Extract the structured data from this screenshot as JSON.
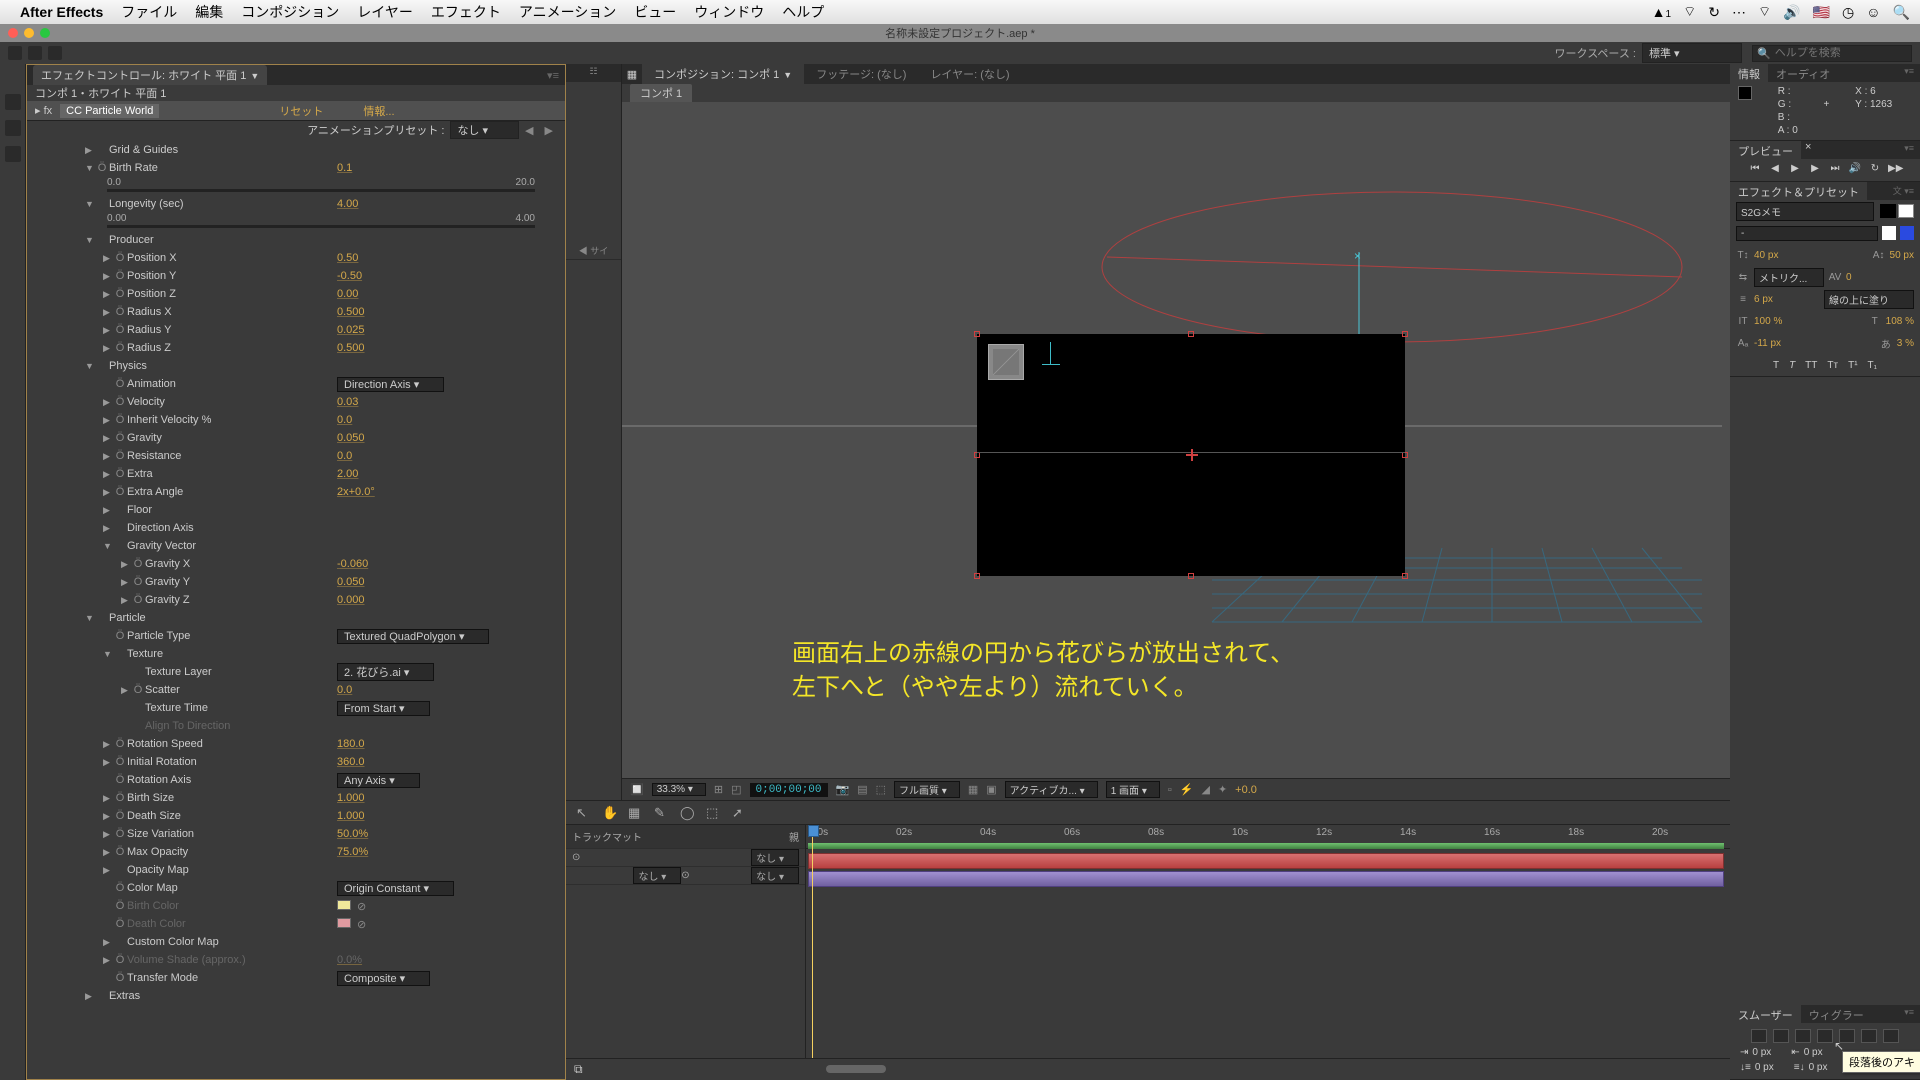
{
  "mac_menu": {
    "app": "After Effects",
    "items": [
      "ファイル",
      "編集",
      "コンポジション",
      "レイヤー",
      "エフェクト",
      "アニメーション",
      "ビュー",
      "ウィンドウ",
      "ヘルプ"
    ],
    "right_badge": "1"
  },
  "window_title": "名称未設定プロジェクト.aep *",
  "workspace": {
    "label": "ワークスペース :",
    "value": "標準",
    "search_placeholder": "ヘルプを検索"
  },
  "effect_panel": {
    "tab": "エフェクトコントロール: ホワイト 平面 1",
    "subtitle": "コンポ 1・ホワイト 平面 1",
    "effect_name": "CC Particle World",
    "reset": "リセット",
    "info": "情報...",
    "anim_preset_label": "アニメーションプリセット :",
    "anim_preset_value": "なし",
    "rows": [
      {
        "indent": 1,
        "tw": "r",
        "label": "Grid & Guides",
        "value": null
      },
      {
        "indent": 1,
        "tw": "d",
        "sw": "Ö",
        "label": "Birth Rate",
        "value": "0.1"
      },
      {
        "slider": true,
        "min": "0.0",
        "max": "20.0"
      },
      {
        "indent": 1,
        "tw": "d",
        "label": "Longevity (sec)",
        "value": "4.00"
      },
      {
        "slider": true,
        "min": "0.00",
        "max": "4.00"
      },
      {
        "indent": 1,
        "tw": "d",
        "label": "Producer",
        "value": null
      },
      {
        "indent": 2,
        "tw": "r",
        "sw": "Ö",
        "label": "Position X",
        "value": "0.50"
      },
      {
        "indent": 2,
        "tw": "r",
        "sw": "Ö",
        "label": "Position Y",
        "value": "-0.50"
      },
      {
        "indent": 2,
        "tw": "r",
        "sw": "Ö",
        "label": "Position Z",
        "value": "0.00"
      },
      {
        "indent": 2,
        "tw": "r",
        "sw": "Ö",
        "label": "Radius X",
        "value": "0.500"
      },
      {
        "indent": 2,
        "tw": "r",
        "sw": "Ö",
        "label": "Radius Y",
        "value": "0.025"
      },
      {
        "indent": 2,
        "tw": "r",
        "sw": "Ö",
        "label": "Radius Z",
        "value": "0.500"
      },
      {
        "indent": 1,
        "tw": "d",
        "label": "Physics",
        "value": null
      },
      {
        "indent": 2,
        "tw": "",
        "sw": "Ö",
        "label": "Animation",
        "dropdown": "Direction Axis"
      },
      {
        "indent": 2,
        "tw": "r",
        "sw": "Ö",
        "label": "Velocity",
        "value": "0.03"
      },
      {
        "indent": 2,
        "tw": "r",
        "sw": "Ö",
        "label": "Inherit Velocity %",
        "value": "0.0"
      },
      {
        "indent": 2,
        "tw": "r",
        "sw": "Ö",
        "label": "Gravity",
        "value": "0.050"
      },
      {
        "indent": 2,
        "tw": "r",
        "sw": "Ö",
        "label": "Resistance",
        "value": "0.0"
      },
      {
        "indent": 2,
        "tw": "r",
        "sw": "Ö",
        "label": "Extra",
        "value": "2.00"
      },
      {
        "indent": 2,
        "tw": "r",
        "sw": "Ö",
        "label": "Extra Angle",
        "value": "2x+0.0°"
      },
      {
        "indent": 2,
        "tw": "r",
        "label": "Floor",
        "value": null
      },
      {
        "indent": 2,
        "tw": "r",
        "label": "Direction Axis",
        "value": null
      },
      {
        "indent": 2,
        "tw": "d",
        "label": "Gravity Vector",
        "value": null
      },
      {
        "indent": 3,
        "tw": "r",
        "sw": "Ö",
        "label": "Gravity X",
        "value": "-0.060"
      },
      {
        "indent": 3,
        "tw": "r",
        "sw": "Ö",
        "label": "Gravity Y",
        "value": "0.050"
      },
      {
        "indent": 3,
        "tw": "r",
        "sw": "Ö",
        "label": "Gravity Z",
        "value": "0.000"
      },
      {
        "indent": 1,
        "tw": "d",
        "label": "Particle",
        "value": null
      },
      {
        "indent": 2,
        "tw": "",
        "sw": "Ö",
        "label": "Particle Type",
        "dropdown": "Textured QuadPolygon"
      },
      {
        "indent": 2,
        "tw": "d",
        "label": "Texture",
        "value": null
      },
      {
        "indent": 3,
        "tw": "",
        "label": "Texture Layer",
        "dropdown": "2. 花びら.ai"
      },
      {
        "indent": 3,
        "tw": "r",
        "sw": "Ö",
        "label": "Scatter",
        "value": "0.0"
      },
      {
        "indent": 3,
        "tw": "",
        "label": "Texture Time",
        "dropdown": "From Start"
      },
      {
        "indent": 3,
        "tw": "",
        "label": "Align To Direction",
        "value": null,
        "disabled": true
      },
      {
        "indent": 2,
        "tw": "r",
        "sw": "Ö",
        "label": "Rotation Speed",
        "value": "180.0"
      },
      {
        "indent": 2,
        "tw": "r",
        "sw": "Ö",
        "label": "Initial Rotation",
        "value": "360.0"
      },
      {
        "indent": 2,
        "tw": "",
        "sw": "Ö",
        "label": "Rotation Axis",
        "dropdown": "Any Axis"
      },
      {
        "indent": 2,
        "tw": "r",
        "sw": "Ö",
        "label": "Birth Size",
        "value": "1.000"
      },
      {
        "indent": 2,
        "tw": "r",
        "sw": "Ö",
        "label": "Death Size",
        "value": "1.000"
      },
      {
        "indent": 2,
        "tw": "r",
        "sw": "Ö",
        "label": "Size Variation",
        "value": "50.0%"
      },
      {
        "indent": 2,
        "tw": "r",
        "sw": "Ö",
        "label": "Max Opacity",
        "value": "75.0%"
      },
      {
        "indent": 2,
        "tw": "r",
        "label": "Opacity Map",
        "value": null
      },
      {
        "indent": 2,
        "tw": "",
        "sw": "Ö",
        "label": "Color Map",
        "dropdown": "Origin Constant"
      },
      {
        "indent": 2,
        "tw": "",
        "sw": "Ö",
        "label": "Birth Color",
        "swatch": "#f0e89a",
        "disabled": true
      },
      {
        "indent": 2,
        "tw": "",
        "sw": "Ö",
        "label": "Death Color",
        "swatch": "#e09aa0",
        "disabled": true
      },
      {
        "indent": 2,
        "tw": "r",
        "label": "Custom Color Map",
        "value": null
      },
      {
        "indent": 2,
        "tw": "r",
        "sw": "Ö",
        "label": "Volume Shade (approx.)",
        "value": "0.0%",
        "disabled": true
      },
      {
        "indent": 2,
        "tw": "",
        "sw": "Ö",
        "label": "Transfer Mode",
        "dropdown": "Composite"
      },
      {
        "indent": 1,
        "tw": "r",
        "label": "Extras",
        "value": null
      }
    ]
  },
  "project_stub_head": "サイ",
  "viewer": {
    "tabs": [
      {
        "label": "コンポジション: コンポ 1",
        "active": true,
        "drop": true
      },
      {
        "label": "フッテージ: (なし)",
        "active": false
      },
      {
        "label": "レイヤー: (なし)",
        "active": false
      }
    ],
    "subtab": "コンポ 1",
    "annotation_line1": "画面右上の赤線の円から花びらが放出されて、",
    "annotation_line2": "左下へと（やや左より）流れていく。",
    "footer": {
      "zoom": "33.3%",
      "timecode": "0;00;00;00",
      "quality": "フル画質",
      "camera": "アクティブカ...",
      "views": "1 画面",
      "exposure": "+0.0"
    }
  },
  "timeline": {
    "ruler": [
      "00s",
      "02s",
      "04s",
      "06s",
      "08s",
      "10s",
      "12s",
      "14s",
      "16s",
      "18s",
      "20s"
    ],
    "trackmatte_head": "トラックマット",
    "tm_head2": "親",
    "dd_none": "なし"
  },
  "info_panel": {
    "tabs": [
      "情報",
      "オーディオ"
    ],
    "R": "R :",
    "G": "G :",
    "B": "B :",
    "A": "A : 0",
    "X": "X : 6",
    "Y": "Y : 1263"
  },
  "preview_panel": {
    "tab": "プレビュー"
  },
  "effects_presets_panel": {
    "tab": "エフェクト＆プリセット"
  },
  "char_panel": {
    "font": "S2Gメモ",
    "style": "-",
    "size": "40 px",
    "leading": "50 px",
    "metric": "メトリク...",
    "tracking": "0",
    "stroke_width": "6 px",
    "stroke_type": "線の上に塗り",
    "scale_w": "100 %",
    "scale_h": "108 %",
    "baseline": "-11 px",
    "tsume": "3 %"
  },
  "smoother_panel": {
    "tabs": [
      "スムーザー",
      "ウィグラー"
    ]
  },
  "align_panel": {
    "val0": "0 px",
    "tooltip": "段落後のアキ"
  }
}
